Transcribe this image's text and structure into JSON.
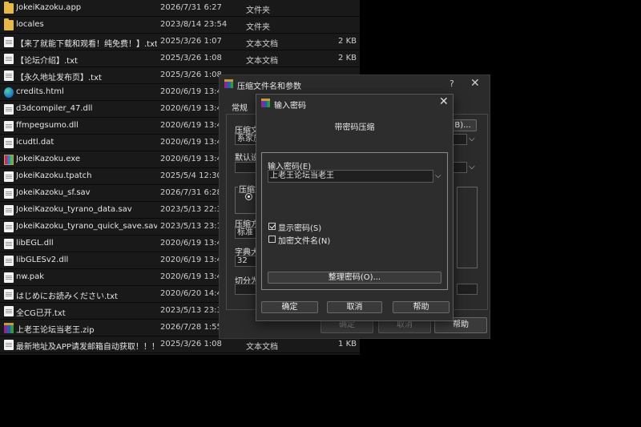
{
  "files": [
    {
      "icon": "folder",
      "name": "JokeiKazoku.app",
      "date": "2026/7/31 6:27",
      "type": "文件夹",
      "size": ""
    },
    {
      "icon": "folder",
      "name": "locales",
      "date": "2023/8/14 23:54",
      "type": "文件夹",
      "size": ""
    },
    {
      "icon": "doc",
      "name": "【来了就能下载和观看！纯免费！】.txt",
      "date": "2025/3/26 1:07",
      "type": "文本文档",
      "size": "2 KB"
    },
    {
      "icon": "doc",
      "name": "【论坛介绍】.txt",
      "date": "2025/3/26 1:08",
      "type": "文本文档",
      "size": "2 KB"
    },
    {
      "icon": "doc",
      "name": "【永久地址发布页】.txt",
      "date": "2025/3/26 1:08",
      "type": "",
      "size": ""
    },
    {
      "icon": "edge",
      "name": "credits.html",
      "date": "2020/6/19 13:43",
      "type": "",
      "size": ""
    },
    {
      "icon": "doc",
      "name": "d3dcompiler_47.dll",
      "date": "2020/6/19 13:43",
      "type": "",
      "size": ""
    },
    {
      "icon": "doc",
      "name": "ffmpegsumo.dll",
      "date": "2020/6/19 13:43",
      "type": "",
      "size": ""
    },
    {
      "icon": "doc",
      "name": "icudtl.dat",
      "date": "2020/6/19 13:43",
      "type": "",
      "size": ""
    },
    {
      "icon": "app",
      "name": "JokeiKazoku.exe",
      "date": "2020/6/19 13:43",
      "type": "",
      "size": ""
    },
    {
      "icon": "doc",
      "name": "JokeiKazoku.tpatch",
      "date": "2025/5/4 12:30",
      "type": "",
      "size": ""
    },
    {
      "icon": "doc",
      "name": "JokeiKazoku_sf.sav",
      "date": "2026/7/31 6:28",
      "type": "",
      "size": ""
    },
    {
      "icon": "doc",
      "name": "JokeiKazoku_tyrano_data.sav",
      "date": "2023/5/13 22:33",
      "type": "",
      "size": ""
    },
    {
      "icon": "doc",
      "name": "JokeiKazoku_tyrano_quick_save.sav",
      "date": "2023/5/13 23:16",
      "type": "",
      "size": ""
    },
    {
      "icon": "doc",
      "name": "libEGL.dll",
      "date": "2020/6/19 13:43",
      "type": "",
      "size": ""
    },
    {
      "icon": "doc",
      "name": "libGLESv2.dll",
      "date": "2020/6/19 13:43",
      "type": "",
      "size": ""
    },
    {
      "icon": "doc",
      "name": "nw.pak",
      "date": "2020/6/19 13:43",
      "type": "",
      "size": ""
    },
    {
      "icon": "doc",
      "name": "はじめにお読みください.txt",
      "date": "2020/6/20 14:42",
      "type": "",
      "size": ""
    },
    {
      "icon": "doc",
      "name": "全CG已开.txt",
      "date": "2023/5/13 23:35",
      "type": "",
      "size": ""
    },
    {
      "icon": "rar",
      "name": "上老王论坛当老王.zip",
      "date": "2026/7/28 1:55",
      "type": "",
      "size": ""
    },
    {
      "icon": "doc",
      "name": "最新地址及APP请发邮箱自动获取！！！....",
      "date": "2025/3/26 1:08",
      "type": "文本文档",
      "size": "1 KB"
    }
  ],
  "archive_dialog": {
    "title": "压缩文件名和参数",
    "help": "?",
    "close": "✕",
    "tab_general": "常规",
    "label_archive_name": "压缩文",
    "archive_name_value": "系家族",
    "browse_label": "B)...",
    "label_default": "默认设",
    "label_format_group": "压缩文",
    "label_method": "压缩方",
    "method_value": "标准",
    "label_dict": "字典大",
    "dict_value": "32",
    "label_split": "切分为",
    "ok": "确定",
    "cancel": "取消",
    "help_button": "帮助"
  },
  "password_dialog": {
    "title": "输入密码",
    "close": "✕",
    "heading": "带密码压缩",
    "password_label": "输入密码(E)",
    "password_value": "上老王论坛当老王",
    "show_password": "显示密码(S)",
    "encrypt_names": "加密文件名(N)",
    "organize": "整理密码(O)...",
    "ok": "确定",
    "cancel": "取消",
    "help": "帮助"
  }
}
